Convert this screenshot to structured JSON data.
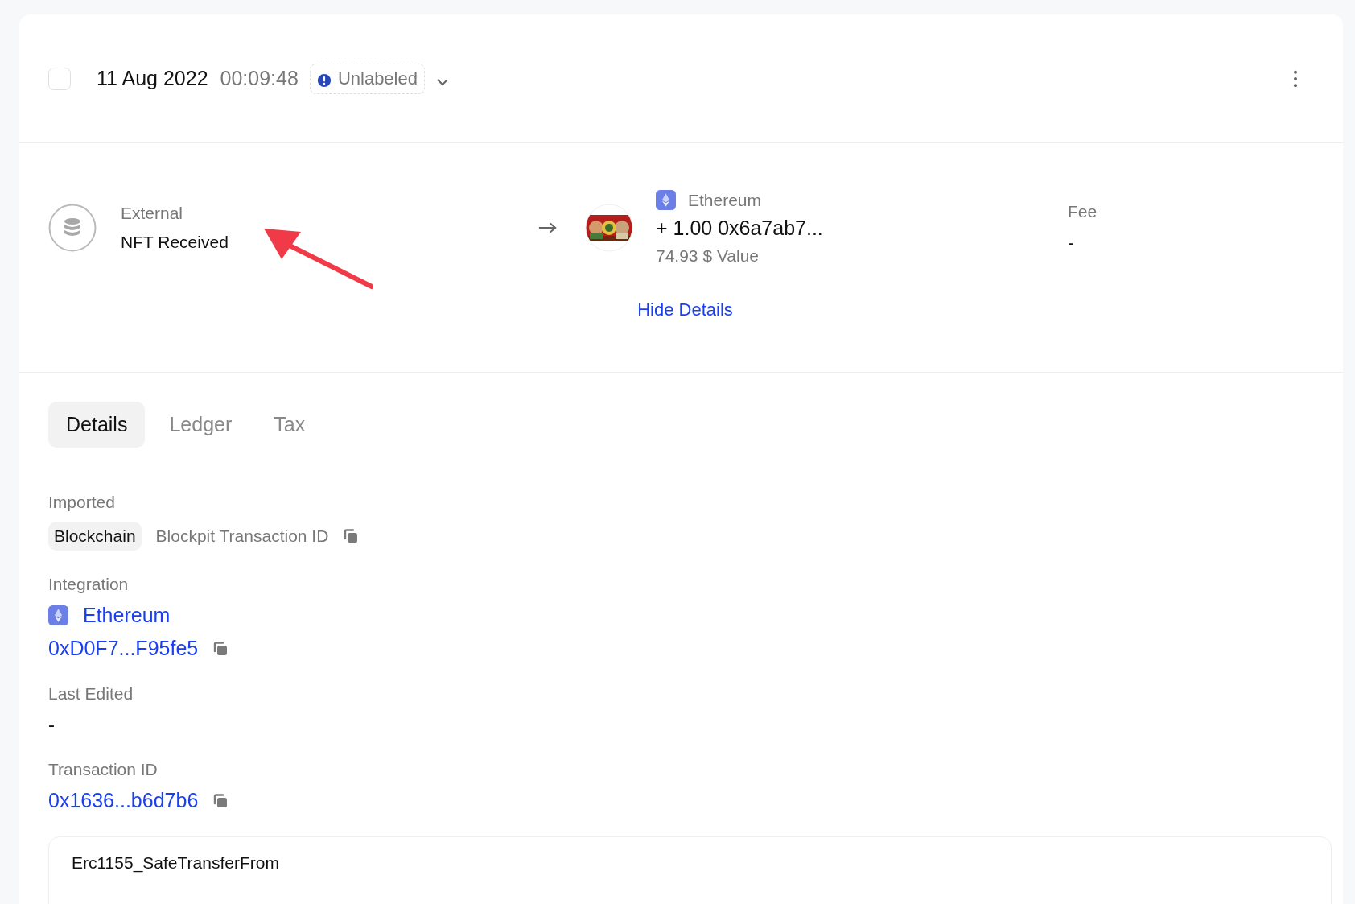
{
  "header": {
    "checked": false,
    "date": "11 Aug 2022",
    "time": "00:09:48",
    "label": "Unlabeled"
  },
  "transaction": {
    "source": {
      "type": "External",
      "title": "NFT Received"
    },
    "asset": {
      "network": "Ethereum",
      "amount": "+ 1.00 0x6a7ab7...",
      "value": "74.93 $ Value"
    },
    "fee": {
      "label": "Fee",
      "value": "-"
    }
  },
  "toggle": "Hide Details",
  "tabs": [
    {
      "label": "Details",
      "selected": true
    },
    {
      "label": "Ledger",
      "selected": false
    },
    {
      "label": "Tax",
      "selected": false
    }
  ],
  "details": [
    {
      "kind": "imported",
      "label": "Imported",
      "tag": "Blockchain",
      "text": "Blockpit Transaction ID"
    },
    {
      "kind": "integration",
      "label": "Integration",
      "network": "Ethereum",
      "address": "0xD0F7...F95fe5"
    },
    {
      "kind": "plain",
      "label": "Last Edited",
      "value": "-"
    },
    {
      "kind": "link",
      "label": "Transaction ID",
      "value": "0x1636...b6d7b6"
    }
  ],
  "method_card": {
    "title": "Erc1155_SafeTransferFrom"
  }
}
